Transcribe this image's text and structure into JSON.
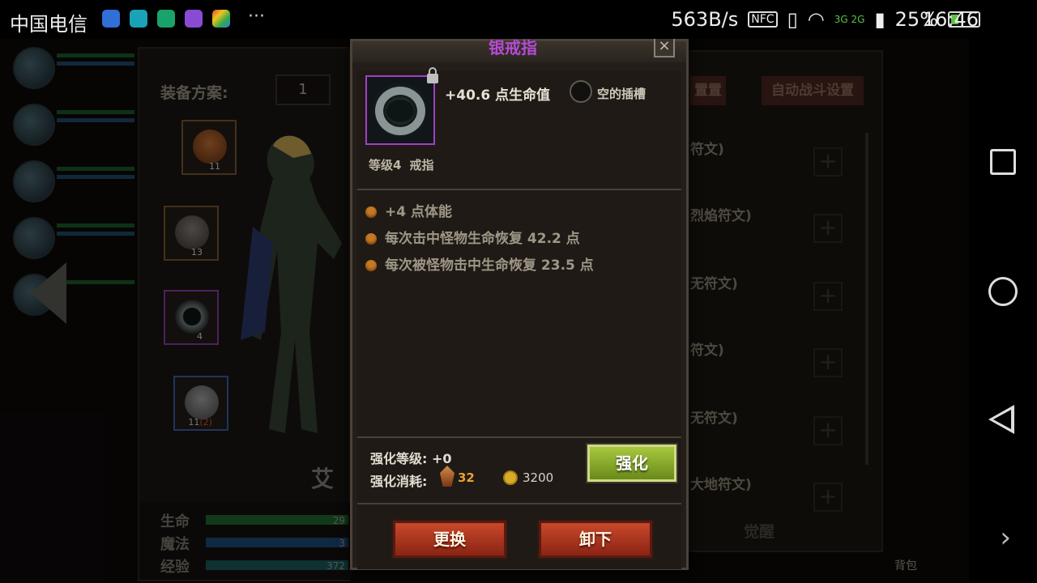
{
  "status_bar": {
    "carrier": "中国电信",
    "net_speed": "563B/s",
    "nfc": "NFC",
    "network": "3G 2G",
    "battery_percent": "25%",
    "battery_level": 0.25,
    "time": "16:46",
    "app_icons": [
      "shield-app-icon",
      "taptap-icon",
      "security-icon",
      "gallery-icon",
      "play-store-icon"
    ]
  },
  "background": {
    "equip_label": "装备方案:",
    "equip_scheme": "1",
    "slots": [
      {
        "name": "helmet",
        "level": "11",
        "bonus": ""
      },
      {
        "name": "armor",
        "level": "13",
        "bonus": ""
      },
      {
        "name": "ring",
        "level": "4",
        "bonus": ""
      },
      {
        "name": "gauntlet",
        "level": "11",
        "bonus": "(2)"
      }
    ],
    "hero_name": "艾",
    "stats": [
      {
        "label": "生命",
        "value": "29",
        "color": "#1f6a32"
      },
      {
        "label": "魔法",
        "value": "3",
        "color": "#1c4c7a"
      },
      {
        "label": "经验",
        "value": "372",
        "color": "#1a5a5a"
      }
    ],
    "right_tabs": [
      "置置",
      "自动战斗设置"
    ],
    "runes": [
      "符文)",
      "烈焰符文)",
      "无符文)",
      "符文)",
      "无符文)",
      "大地符文)"
    ],
    "rune_add": "+",
    "awaken": "觉醒",
    "bag": "背包"
  },
  "modal": {
    "title": "银戒指",
    "close": "×",
    "item": {
      "main_stat": "+40.6 点生命值",
      "socket_label": "空的插槽",
      "level_label": "等级4",
      "type_label": "戒指"
    },
    "attributes": [
      "+4 点体能",
      "每次击中怪物生命恢复 42.2 点",
      "每次被怪物击中生命恢复 23.5 点"
    ],
    "enhance_level": "强化等级: +0",
    "enhance_cost_label": "强化消耗:",
    "gem_cost": "32",
    "gold_cost": "3200",
    "enhance_button": "强化",
    "replace_button": "更换",
    "remove_button": "卸下"
  }
}
